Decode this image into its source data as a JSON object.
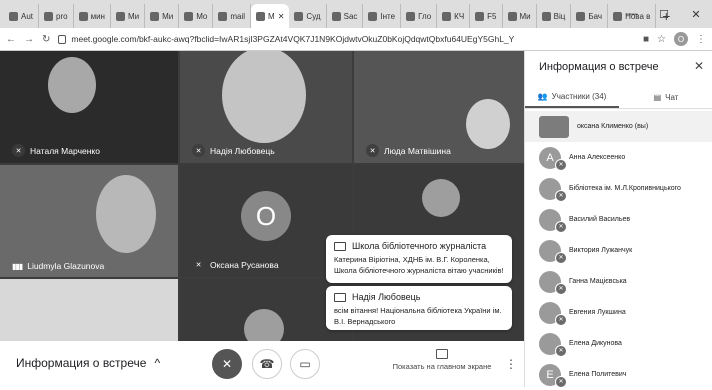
{
  "browser": {
    "tabs": [
      {
        "label": "Aut"
      },
      {
        "label": "pro"
      },
      {
        "label": "мин"
      },
      {
        "label": "Ми"
      },
      {
        "label": "Ми"
      },
      {
        "label": "Mo"
      },
      {
        "label": "mail"
      },
      {
        "label": "M"
      },
      {
        "label": "Суд"
      },
      {
        "label": "Sac"
      },
      {
        "label": "Інте"
      },
      {
        "label": "Гло"
      },
      {
        "label": "КЧ"
      },
      {
        "label": "F5"
      },
      {
        "label": "Ми"
      },
      {
        "label": "Віц"
      },
      {
        "label": "Бач"
      },
      {
        "label": "Нова в"
      }
    ],
    "url": "meet.google.com/bkf-aukc-awq?fbclid=IwAR1sjI3PGZAt4VQK7J1N9KOjdwtvOkuZ0bKojQdqwtQbxfu64UEgY5GhL_Y",
    "profile_initial": "O"
  },
  "tiles": [
    {
      "name": "Наталя Марченко"
    },
    {
      "name": "Надія Любовець"
    },
    {
      "name": "Люда Матвішина"
    },
    {
      "name": "Liudmyla Glazunova"
    },
    {
      "name": "Оксана Русанова",
      "initial": "O"
    }
  ],
  "popups": [
    {
      "title": "Школа бібліотечного журналіста",
      "text": "Катерина Віріотіна, ХДНБ ім. В.Г. Короленка, Школа бібліотечного журналіста вітаю учасників!"
    },
    {
      "title": "Надія Любовець",
      "text": "всім вітання! Національна бібліотека України ім. В.І. Вернадського"
    }
  ],
  "bottom": {
    "meeting_info": "Информация о встрече",
    "present_label": "Показать на главном экране"
  },
  "panel": {
    "title": "Информация о встрече",
    "participants_tab": "Участники (34)",
    "chat_tab": "Чат",
    "participants": [
      {
        "name": "оксана Клименко (вы)",
        "initial": ""
      },
      {
        "name": "Анна Алексеенко",
        "initial": "A"
      },
      {
        "name": "Бібліотека ім. М.Л.Кропивницького",
        "initial": ""
      },
      {
        "name": "Василий Васильев",
        "initial": ""
      },
      {
        "name": "Виктория Лужанчук",
        "initial": ""
      },
      {
        "name": "Ганна Мацієвська",
        "initial": ""
      },
      {
        "name": "Евгения Лукшина",
        "initial": ""
      },
      {
        "name": "Елена Дикунова",
        "initial": ""
      },
      {
        "name": "Елена Политевич",
        "initial": "E"
      }
    ]
  }
}
